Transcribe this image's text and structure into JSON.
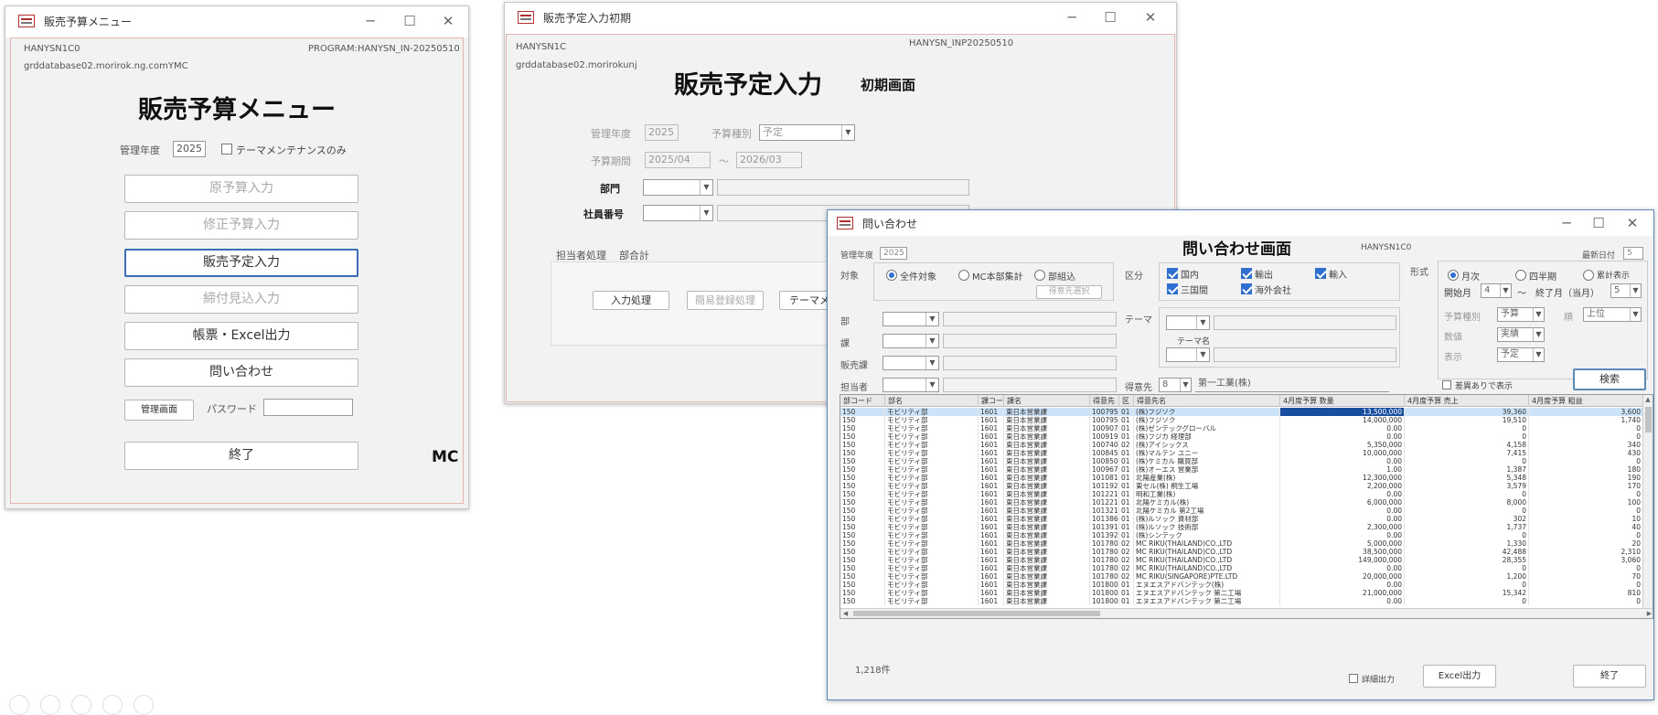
{
  "menu_window": {
    "title": "販売予算メニュー",
    "user": "HANYSN1C0",
    "program": "PROGRAM:HANYSN_IN-20250510",
    "db": "grddatabase02.morirok.ng.comYMC",
    "heading": "販売予算メニュー",
    "year_label": "管理年度",
    "year_value": "2025",
    "maintenance_only": "テーマメンテナンスのみ",
    "buttons": [
      "原予算入力",
      "修正予算入力",
      "販売予定入力",
      "締付見込入力",
      "帳票・Excel出力",
      "問い合わせ"
    ],
    "admin_button": "管理画面",
    "password_label": "パスワード",
    "exit_button": "終了",
    "logo": "MC"
  },
  "input_window": {
    "title": "販売予定入力初期",
    "user": "HANYSN1C",
    "program": "HANYSN_INP20250510",
    "db": "grddatabase02.morirokunj",
    "heading": "販売予定入力",
    "subheading": "初期画面",
    "year_label": "管理年度",
    "year_value": "2025",
    "type_label": "予算種別",
    "type_value": "予定",
    "period_label": "予算期間",
    "period_from": "2025/04",
    "period_sep": "～",
    "period_to": "2026/03",
    "dept_label": "部門",
    "emp_label": "社員番号",
    "tab_label": "担当者処理",
    "tab_label2": "部合計",
    "btn_input": "入力処理",
    "btn_simple": "簡易登録処理",
    "btn_theme": "テーマメ"
  },
  "inquiry_window": {
    "title": "問い合わせ",
    "heading": "問い合わせ画面",
    "user": "HANYSN1C0",
    "year_label": "管理年度",
    "year_value": "2025",
    "right_top_label": "最新日付",
    "right_top_value": "5",
    "target_label": "対象",
    "target_opts": [
      "全件対象",
      "MC本部集計",
      "部組込"
    ],
    "sub_button": "得意先選択",
    "cat_label": "区分",
    "cat_opts": [
      "国内",
      "輸出",
      "輸入",
      "三国間",
      "海外会社"
    ],
    "form_label": "形式",
    "form_opts": [
      "月次",
      "四半期",
      "累計表示"
    ],
    "month_label": "開始月",
    "month_value": "4",
    "month_sep": "～",
    "month_end_label": "終了月（当月）",
    "month_end_value": "5",
    "left_labels": [
      "部",
      "課",
      "販売課",
      "担当者"
    ],
    "theme_label": "テーマ",
    "theme_sub": "テーマ名",
    "cust_label": "得意先",
    "cust_code": "8",
    "cust_name": "第一工業(株)",
    "r_labels": [
      "予算種別",
      "数値",
      "表示"
    ],
    "r_vals": [
      "予算",
      "実績",
      "予定"
    ],
    "r_extra_label": "順",
    "r_extra_value": "上位",
    "diff_label": "差異ありで表示",
    "search_button": "検索",
    "columns": [
      "部コード",
      "部名",
      "課コード",
      "課名",
      "得意先",
      "区",
      "得意先名",
      "4月度予算 数量",
      "4月度予算 売上",
      "4月度予算 粗益"
    ],
    "rows": [
      [
        "150",
        "モビリティ部",
        "1601",
        "東日本営業課",
        "100795",
        "01",
        "(株)フジソク",
        "13,500,000",
        "39,360",
        "3,600"
      ],
      [
        "150",
        "モビリティ部",
        "1601",
        "東日本営業課",
        "100795",
        "01",
        "(株)フジソク",
        "14,000,000",
        "19,510",
        "1,740"
      ],
      [
        "150",
        "モビリティ部",
        "1601",
        "東日本営業課",
        "100907",
        "01",
        "(株)ゼンテックグローバル",
        "0.00",
        "0",
        "0"
      ],
      [
        "150",
        "モビリティ部",
        "1601",
        "東日本営業課",
        "100919",
        "01",
        "(株)フジカ 経理部",
        "0.00",
        "0",
        "0"
      ],
      [
        "150",
        "モビリティ部",
        "1601",
        "東日本営業課",
        "100740",
        "02",
        "(株)アイシックス",
        "5,350,000",
        "4,158",
        "340"
      ],
      [
        "150",
        "モビリティ部",
        "1601",
        "東日本営業課",
        "100845",
        "01",
        "(株)マルテン ユニー",
        "10,000,000",
        "7,415",
        "430"
      ],
      [
        "150",
        "モビリティ部",
        "1601",
        "東日本営業課",
        "100850",
        "01",
        "(株)ケミカル 購買部",
        "0.00",
        "0",
        "0"
      ],
      [
        "150",
        "モビリティ部",
        "1601",
        "東日本営業課",
        "100967",
        "01",
        "(株)オーエス 営業部",
        "1.00",
        "1,387",
        "180"
      ],
      [
        "150",
        "モビリティ部",
        "1601",
        "東日本営業課",
        "101081",
        "01",
        "北陽産業(株)",
        "12,300,000",
        "5,348",
        "190"
      ],
      [
        "150",
        "モビリティ部",
        "1601",
        "東日本営業課",
        "101192",
        "01",
        "東セル(株) 桐生工場",
        "2,200,000",
        "3,579",
        "170"
      ],
      [
        "150",
        "モビリティ部",
        "1601",
        "東日本営業課",
        "101221",
        "01",
        "明和工業(株)",
        "0.00",
        "0",
        "0"
      ],
      [
        "150",
        "モビリティ部",
        "1601",
        "東日本営業課",
        "101221",
        "01",
        "北陽ケミカル(株)",
        "6,000,000",
        "8,000",
        "100"
      ],
      [
        "150",
        "モビリティ部",
        "1601",
        "東日本営業課",
        "101321",
        "01",
        "北陽ケミカル 第2工場",
        "0.00",
        "0",
        "0"
      ],
      [
        "150",
        "モビリティ部",
        "1601",
        "東日本営業課",
        "101386",
        "01",
        "(株)ルソック 資材部",
        "0.00",
        "302",
        "10"
      ],
      [
        "150",
        "モビリティ部",
        "1601",
        "東日本営業課",
        "101391",
        "01",
        "(株)ルソック 技術部",
        "2,300,000",
        "1,737",
        "40"
      ],
      [
        "150",
        "モビリティ部",
        "1601",
        "東日本営業課",
        "101392",
        "01",
        "(株)シンテック",
        "0.00",
        "0",
        "0"
      ],
      [
        "150",
        "モビリティ部",
        "1601",
        "東日本営業課",
        "101780",
        "02",
        "MC RIKU(THAILAND)CO.,LTD",
        "5,000,000",
        "1,330",
        "20"
      ],
      [
        "150",
        "モビリティ部",
        "1601",
        "東日本営業課",
        "101780",
        "02",
        "MC RIKU(THAILAND)CO.,LTD",
        "38,500,000",
        "42,488",
        "2,310"
      ],
      [
        "150",
        "モビリティ部",
        "1601",
        "東日本営業課",
        "101780",
        "02",
        "MC RIKU(THAILAND)CO.,LTD",
        "149,000,000",
        "28,355",
        "3,060"
      ],
      [
        "150",
        "モビリティ部",
        "1601",
        "東日本営業課",
        "101780",
        "02",
        "MC RIKU(THAILAND)CO.,LTD",
        "0.00",
        "0",
        "0"
      ],
      [
        "150",
        "モビリティ部",
        "1601",
        "東日本営業課",
        "101780",
        "02",
        "MC RIKU(SINGAPORE)PTE.LTD",
        "20,000,000",
        "1,200",
        "70"
      ],
      [
        "150",
        "モビリティ部",
        "1601",
        "東日本営業課",
        "101800",
        "01",
        "エヌエスアドバンテック(株)",
        "0.00",
        "0",
        "0"
      ],
      [
        "150",
        "モビリティ部",
        "1601",
        "東日本営業課",
        "101800",
        "01",
        "エヌエスアドバンテック 第二工場",
        "21,000,000",
        "15,342",
        "810"
      ],
      [
        "150",
        "モビリティ部",
        "1601",
        "東日本営業課",
        "101800",
        "01",
        "エヌエスアドバンテック 第二工場",
        "0.00",
        "0",
        "0"
      ]
    ],
    "record_count": "1,218件",
    "excel_chk": "詳細出力",
    "excel_button": "Excel出力",
    "exit_button": "終了"
  }
}
